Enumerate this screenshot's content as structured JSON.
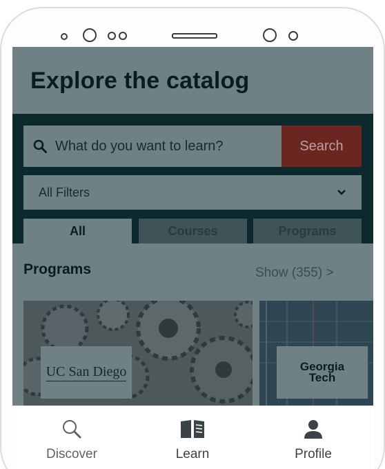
{
  "header": {
    "title": "Explore the catalog"
  },
  "search": {
    "placeholder": "What do you want to learn?",
    "button_label": "Search",
    "filters_label": "All Filters"
  },
  "tabs": [
    {
      "label": "All",
      "active": true
    },
    {
      "label": "Courses",
      "active": false
    },
    {
      "label": "Programs",
      "active": false
    }
  ],
  "programs": {
    "heading": "Programs",
    "show_link": "Show (355) >",
    "cards": [
      {
        "partner": "UC San Diego"
      },
      {
        "partner_line1": "Georgia",
        "partner_line2": "Tech"
      }
    ]
  },
  "bottom_nav": {
    "items": [
      {
        "label": "Discover",
        "icon": "search-icon",
        "active": true
      },
      {
        "label": "Learn",
        "icon": "book-icon",
        "active": false
      },
      {
        "label": "Profile",
        "icon": "person-icon",
        "active": false
      }
    ]
  },
  "colors": {
    "overlay": "#6f8185",
    "search_area": "#0c2a2e",
    "search_button": "#6b2622"
  }
}
